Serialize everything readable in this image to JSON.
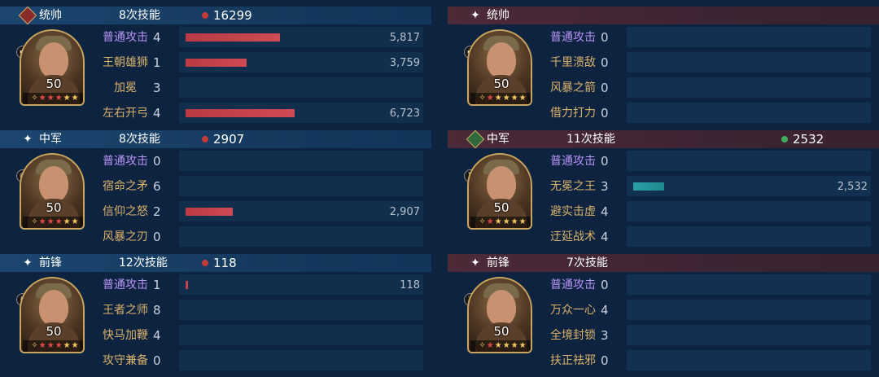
{
  "left": {
    "blocks": [
      {
        "role": "统帅",
        "badge": "red",
        "casts": "8次技能",
        "dmg_color": "#c23b3b",
        "damage": "16299",
        "level": "50",
        "red_stars": 3,
        "gold_stars": 2,
        "type_icon": "rifle-icon",
        "skills": [
          {
            "name": "普通攻击",
            "normal": true,
            "count": "4",
            "bar_fraction": 0.52,
            "value": "5,817"
          },
          {
            "name": "王朝雄狮",
            "normal": false,
            "count": "1",
            "bar_fraction": 0.336,
            "value": "3,759"
          },
          {
            "name": "加冕",
            "normal": false,
            "centered": true,
            "count": "3",
            "bar_fraction": 0,
            "value": ""
          },
          {
            "name": "左右开弓",
            "normal": false,
            "count": "4",
            "bar_fraction": 0.6,
            "value": "6,723"
          }
        ]
      },
      {
        "role": "中军",
        "badge": "star",
        "casts": "8次技能",
        "dmg_color": "#c23b3b",
        "damage": "2907",
        "level": "50",
        "red_stars": 3,
        "gold_stars": 2,
        "type_icon": "cannon-icon",
        "skills": [
          {
            "name": "普通攻击",
            "normal": true,
            "count": "0",
            "bar_fraction": 0,
            "value": ""
          },
          {
            "name": "宿命之矛",
            "normal": false,
            "count": "6",
            "bar_fraction": 0,
            "value": ""
          },
          {
            "name": "信仰之怒",
            "normal": false,
            "count": "2",
            "bar_fraction": 0.26,
            "value": "2,907"
          },
          {
            "name": "风暴之刃",
            "normal": false,
            "count": "0",
            "bar_fraction": 0,
            "value": ""
          }
        ]
      },
      {
        "role": "前锋",
        "badge": "star",
        "casts": "12次技能",
        "dmg_color": "#c23b3b",
        "damage": "118",
        "level": "50",
        "red_stars": 3,
        "gold_stars": 2,
        "type_icon": "horse-icon",
        "skills": [
          {
            "name": "普通攻击",
            "normal": true,
            "count": "1",
            "bar_fraction": 0.012,
            "value": "118"
          },
          {
            "name": "王者之师",
            "normal": false,
            "count": "8",
            "bar_fraction": 0,
            "value": ""
          },
          {
            "name": "快马加鞭",
            "normal": false,
            "count": "4",
            "bar_fraction": 0,
            "value": ""
          },
          {
            "name": "攻守兼备",
            "normal": false,
            "count": "0",
            "bar_fraction": 0,
            "value": ""
          }
        ]
      }
    ]
  },
  "right": {
    "blocks": [
      {
        "role": "统帅",
        "badge": "star",
        "casts": "",
        "dmg_color": "",
        "damage": "",
        "level": "50",
        "red_stars": 1,
        "gold_stars": 4,
        "type_icon": "rifle-icon",
        "skills": [
          {
            "name": "普通攻击",
            "normal": true,
            "count": "0",
            "bar_fraction": 0,
            "value": ""
          },
          {
            "name": "千里溃敌",
            "normal": false,
            "count": "0",
            "bar_fraction": 0,
            "value": ""
          },
          {
            "name": "风暴之箭",
            "normal": false,
            "count": "0",
            "bar_fraction": 0,
            "value": ""
          },
          {
            "name": "借力打力",
            "normal": false,
            "count": "0",
            "bar_fraction": 0,
            "value": ""
          }
        ]
      },
      {
        "role": "中军",
        "badge": "green",
        "casts": "11次技能",
        "dmg_color": "#3fae5a",
        "damage": "2532",
        "level": "50",
        "red_stars": 1,
        "gold_stars": 4,
        "type_icon": "castle-icon",
        "skills": [
          {
            "name": "普通攻击",
            "normal": true,
            "count": "0",
            "bar_fraction": 0,
            "value": ""
          },
          {
            "name": "无冕之王",
            "normal": false,
            "count": "3",
            "bar_fraction": 0.17,
            "value": "2,532",
            "bar_color": "teal"
          },
          {
            "name": "避实击虚",
            "normal": false,
            "count": "4",
            "bar_fraction": 0,
            "value": ""
          },
          {
            "name": "迂延战术",
            "normal": false,
            "count": "4",
            "bar_fraction": 0,
            "value": ""
          }
        ]
      },
      {
        "role": "前锋",
        "badge": "star",
        "casts": "7次技能",
        "dmg_color": "",
        "damage": "",
        "level": "50",
        "red_stars": 1,
        "gold_stars": 4,
        "type_icon": "sword-icon",
        "skills": [
          {
            "name": "普通攻击",
            "normal": true,
            "count": "0",
            "bar_fraction": 0,
            "value": ""
          },
          {
            "name": "万众一心",
            "normal": false,
            "count": "4",
            "bar_fraction": 0,
            "value": ""
          },
          {
            "name": "全境封锁",
            "normal": false,
            "count": "3",
            "bar_fraction": 0,
            "value": ""
          },
          {
            "name": "扶正祛邪",
            "normal": false,
            "count": "0",
            "bar_fraction": 0,
            "value": ""
          }
        ]
      }
    ]
  }
}
